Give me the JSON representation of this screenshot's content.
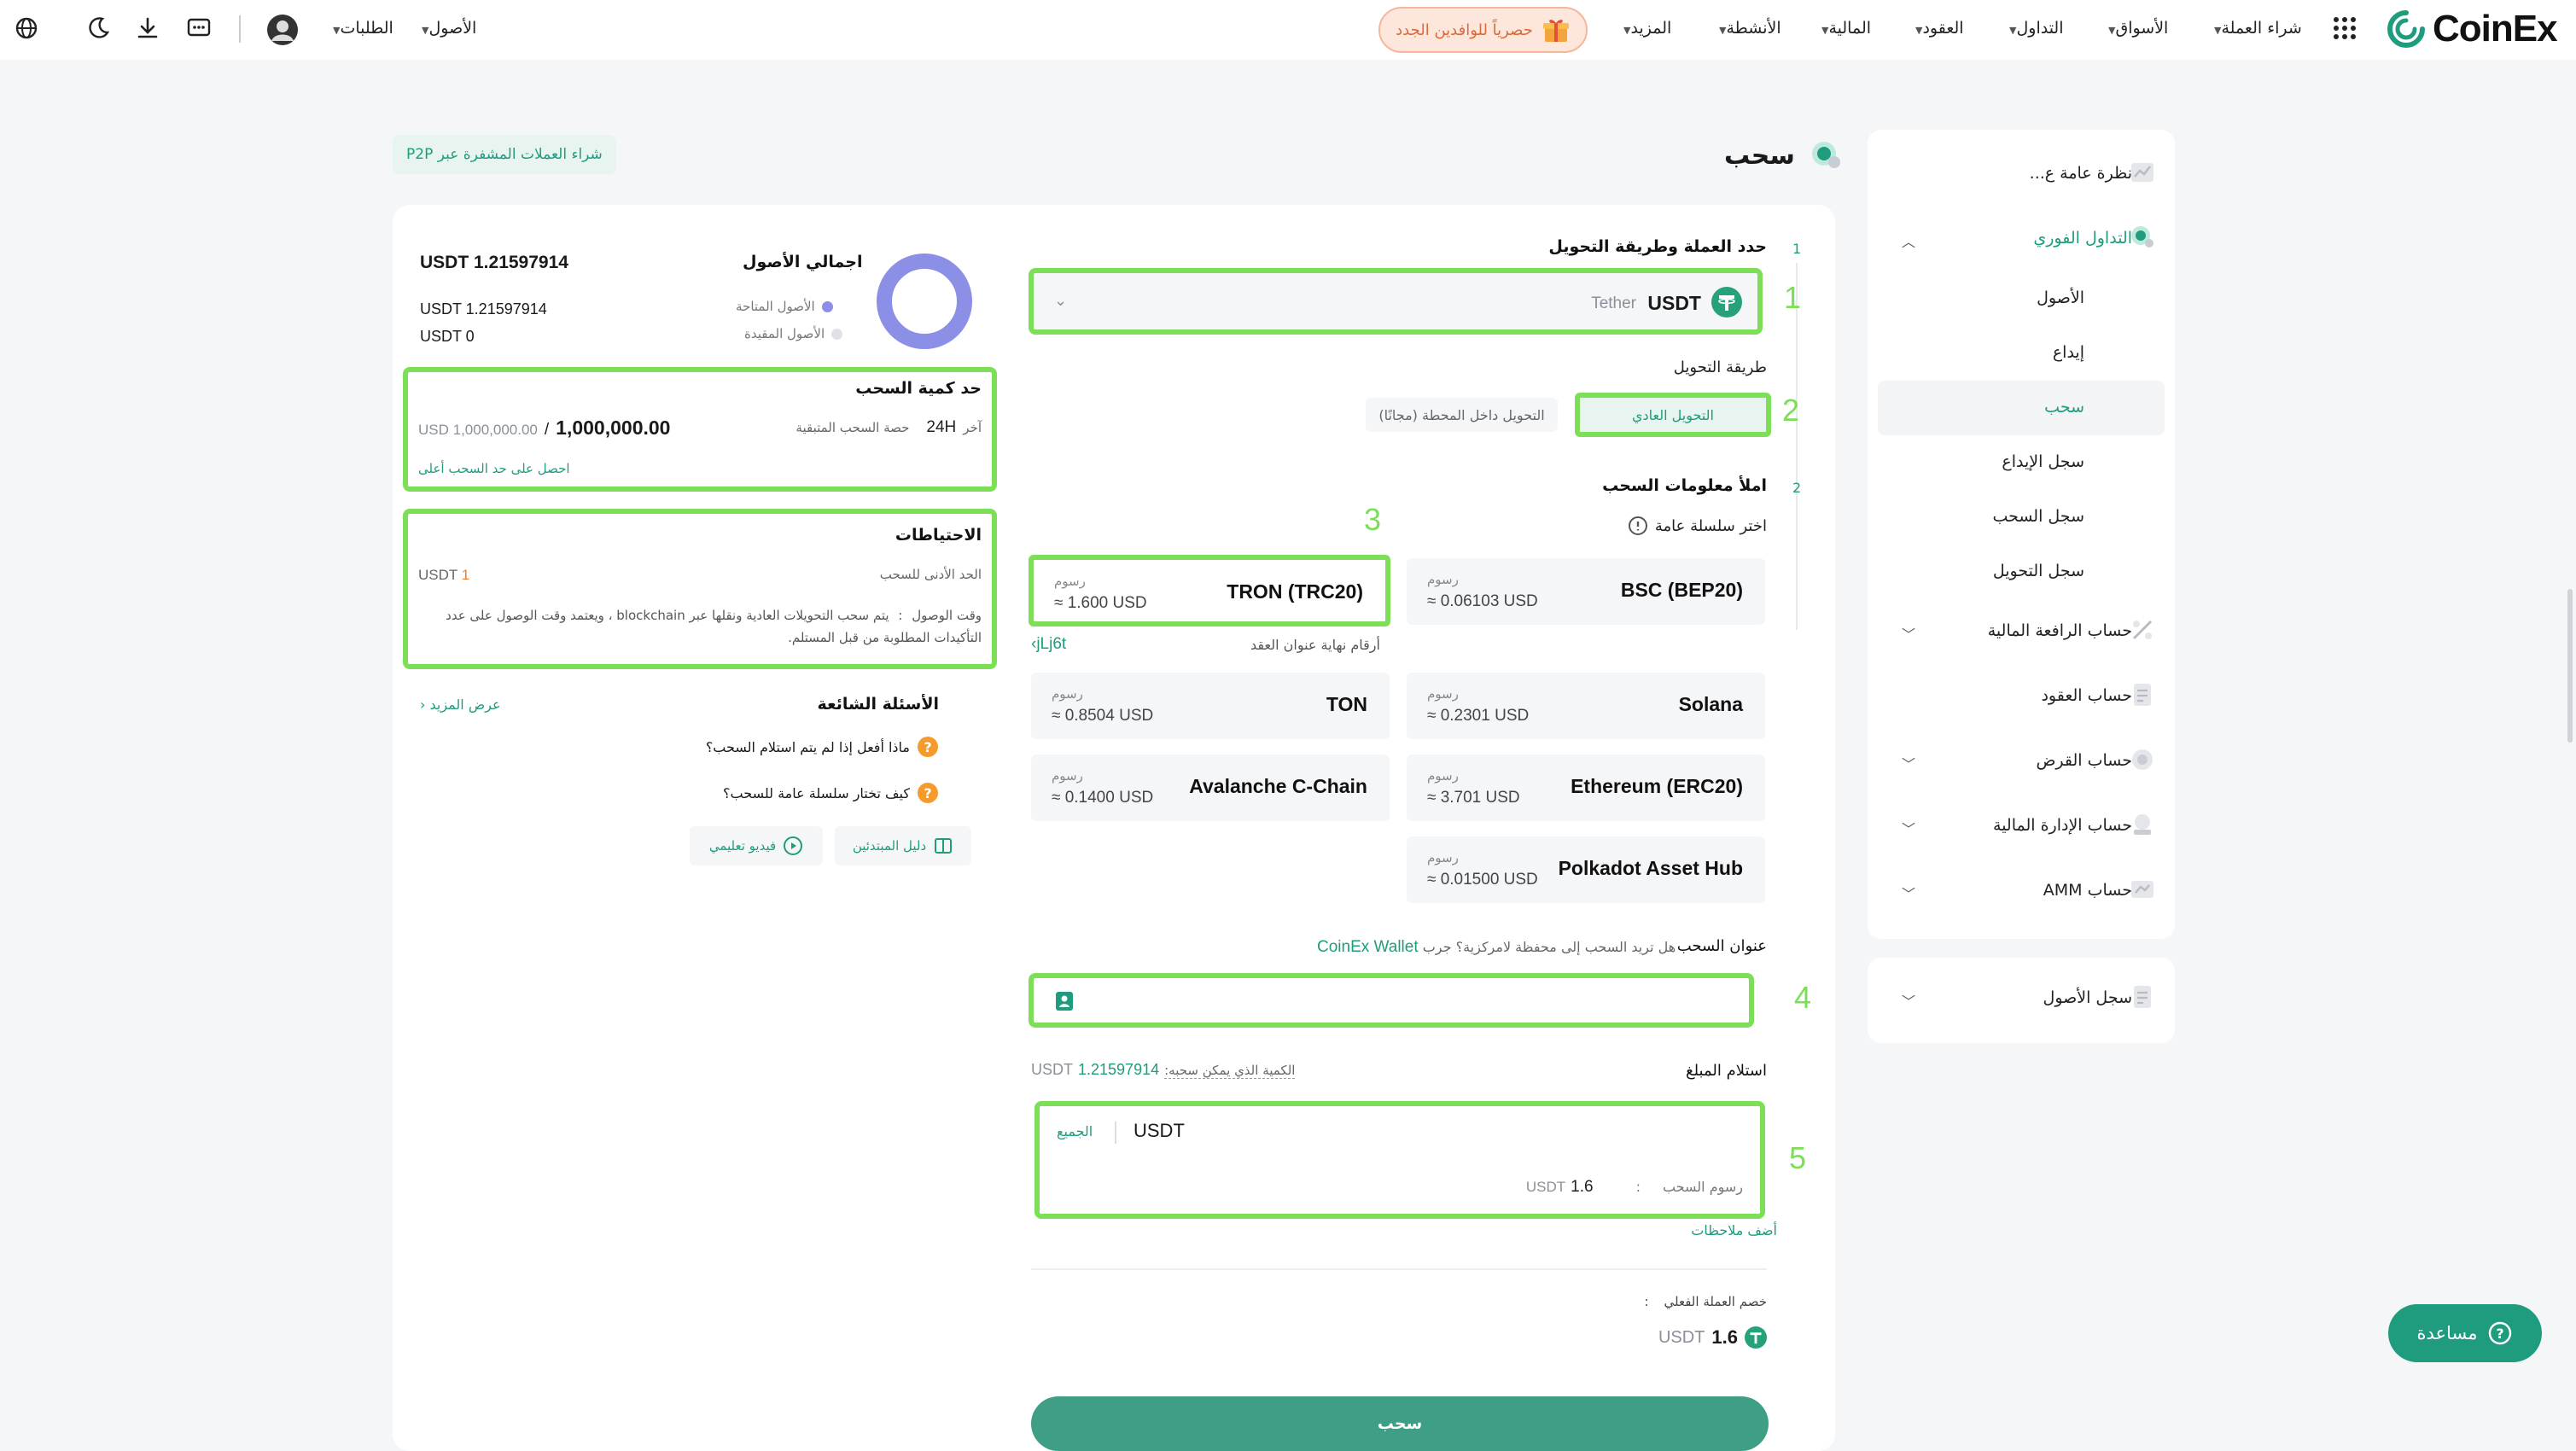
{
  "topbar": {
    "brand": "CoinEx",
    "nav": [
      {
        "label": "شراء العملة"
      },
      {
        "label": "الأسواق"
      },
      {
        "label": "التداول"
      },
      {
        "label": "العقود"
      },
      {
        "label": "المالية"
      },
      {
        "label": "الأنشطة"
      },
      {
        "label": "المزيد"
      }
    ],
    "promo": "حصرياً للوافدين الجدد",
    "assets_menu": "الأصول",
    "orders_menu": "الطلبات"
  },
  "page": {
    "title": "سحب",
    "p2p_link": "شراء العملات المشفرة عبر P2P"
  },
  "sidebar": {
    "items": [
      {
        "label": "نظرة عامة ع..."
      },
      {
        "label": "التداول الفوري"
      },
      {
        "label": "الأصول"
      },
      {
        "label": "إيداع"
      },
      {
        "label": "سحب"
      },
      {
        "label": "سجل الإيداع"
      },
      {
        "label": "سجل السحب"
      },
      {
        "label": "سجل التحويل"
      },
      {
        "label": "حساب الرافعة المالية"
      },
      {
        "label": "حساب العقود"
      },
      {
        "label": "حساب القرض"
      },
      {
        "label": "حساب الإدارة المالية"
      },
      {
        "label": "حساب AMM"
      }
    ],
    "history": "سجل الأصول"
  },
  "form": {
    "step1_label": "حدد العملة وطريقة التحويل",
    "step1_no": "1",
    "coin_symbol": "USDT",
    "coin_name": "Tether",
    "method_label": "طريقة التحويل",
    "method_normal": "التحويل العادي",
    "method_internal": "التحويل داخل المحطة (مجانًا)",
    "step2_label": "املأ معلومات السحب",
    "step2_no": "2",
    "chain_label": "اختر سلسلة عامة",
    "fee_label": "رسوم",
    "contract_label": "أرقام نهاية عنوان العقد",
    "contract_suffix": "jLj6t",
    "chains": [
      {
        "name": "TRON (TRC20)",
        "fee": "≈ 1.600 USD"
      },
      {
        "name": "BSC (BEP20)",
        "fee": "≈ 0.06103 USD"
      },
      {
        "name": "TON",
        "fee": "≈ 0.8504 USD"
      },
      {
        "name": "Solana",
        "fee": "≈ 0.2301 USD"
      },
      {
        "name": "Avalanche C-Chain",
        "fee": "≈ 0.1400 USD"
      },
      {
        "name": "Ethereum (ERC20)",
        "fee": "≈ 3.701 USD"
      },
      {
        "name": "Polkadot Asset Hub",
        "fee": "≈ 0.01500 USD"
      }
    ],
    "address_label": "عنوان السحب",
    "address_hint": "هل تريد السحب إلى محفظة لامركزية؟ جرب",
    "address_hint_link": "CoinEx Wallet",
    "receive_label": "استلام المبلغ",
    "withdrawable_label": "الكمية الذي يمكن سحبه:",
    "withdrawable_value": "1.21597914",
    "withdrawable_unit": "USDT",
    "amount_unit": "USDT",
    "all_label": "الجميع",
    "fee_row_label": "رسوم السحب",
    "fee_row_value": "1.6",
    "fee_row_unit": "USDT",
    "add_note": "أضف ملاحظات",
    "actual_label": "خصم العملة الفعلي",
    "actual_value": "1.6",
    "actual_unit": "USDT",
    "submit": "سحب"
  },
  "steps": {
    "s1": "1",
    "s2": "2",
    "s3": "3",
    "s4": "4",
    "s5": "5"
  },
  "assets": {
    "title": "اجمالي الأصول",
    "total": "USDT 1.21597914",
    "available_label": "الأصول المتاحة",
    "available_value": "USDT 1.21597914",
    "frozen_label": "الأصول المقيدة",
    "frozen_value": "USDT 0",
    "ring_color": "#8b8fe6"
  },
  "limit": {
    "title": "حد كمية السحب",
    "period_prefix": "آخر",
    "period": "24H",
    "remaining_label": "حصة السحب المتبقية",
    "remaining_value": "1,000,000.00",
    "sep": "/",
    "max_value": "USD 1,000,000.00",
    "link": "احصل على حد السحب أعلى"
  },
  "notes": {
    "title": "الاحتياطات",
    "min_label": "الحد الأدنى للسحب",
    "min_value": "1",
    "min_unit": "USDT",
    "time_label": "وقت الوصول",
    "time_text": "يتم سحب التحويلات العادية ونقلها عبر blockchain ، ويعتمد وقت الوصول على عدد التأكيدات المطلوبة من قبل المستلم."
  },
  "faq": {
    "title": "الأسئلة الشائعة",
    "more": "عرض المزيد",
    "q1": "ماذا أفعل إذا لم يتم استلام السحب؟",
    "q2": "كيف تختار سلسلة عامة للسحب؟",
    "guide": "دليل المبتدئين",
    "video": "فيديو تعليمي"
  },
  "help": "مساعدة",
  "colors": {
    "accent": "#1f9c7e",
    "highlight": "#7dde58",
    "promo": "#d86a3c"
  }
}
